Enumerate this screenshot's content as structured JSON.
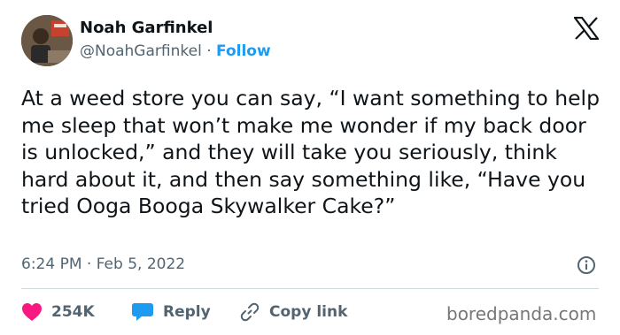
{
  "author": {
    "name": "Noah Garfinkel",
    "handle": "@NoahGarfinkel",
    "separator": "·",
    "follow_label": "Follow"
  },
  "tweet": {
    "text": "At a weed store you can say, “I want something to help me sleep that won’t make me wonder if my back door is unlocked,” and they will take you seriously, think hard about it, and then say something like, “Have you tried Ooga Booga Skywalker Cake?”",
    "timestamp": "6:24 PM · Feb 5, 2022"
  },
  "actions": {
    "likes_count": "254K",
    "reply_label": "Reply",
    "copy_link_label": "Copy link"
  },
  "watermark": "boredpanda.com",
  "icons": [
    "x-logo-icon",
    "info-icon",
    "heart-icon",
    "reply-bubble-icon",
    "link-icon"
  ],
  "colors": {
    "follow_blue": "#1d9bf0",
    "like_red": "#f91880",
    "reply_blue": "#1d9bf0",
    "secondary_text": "#536471"
  }
}
